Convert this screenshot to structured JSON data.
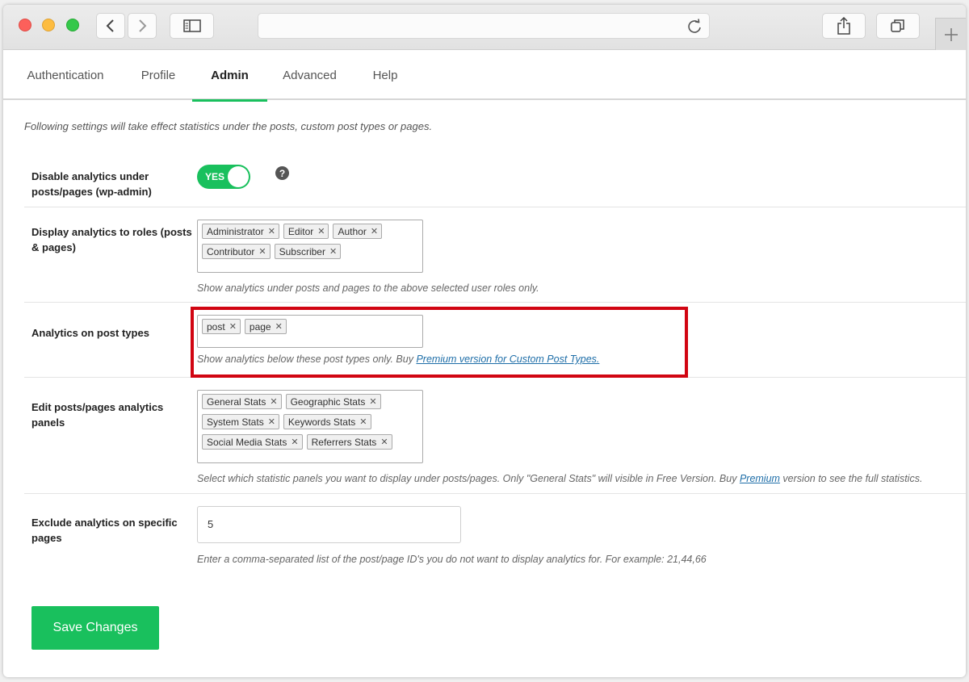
{
  "tabs": [
    {
      "label": "Authentication"
    },
    {
      "label": "Profile"
    },
    {
      "label": "Admin"
    },
    {
      "label": "Advanced"
    },
    {
      "label": "Help"
    }
  ],
  "intro": "Following settings will take effect statistics under the posts, custom post types or pages.",
  "settings": {
    "disable": {
      "label": "Disable analytics under posts/pages (wp-admin)",
      "toggle_value": "YES",
      "help_glyph": "?"
    },
    "roles": {
      "label": "Display analytics to roles (posts & pages)",
      "tags": [
        "Administrator",
        "Editor",
        "Author",
        "Contributor",
        "Subscriber"
      ],
      "description": "Show analytics under posts and pages to the above selected user roles only."
    },
    "post_types": {
      "label": "Analytics on post types",
      "tags": [
        "post",
        "page"
      ],
      "description": "Show analytics below these post types only. Buy ",
      "link_text": "Premium version for Custom Post Types."
    },
    "panels": {
      "label": "Edit posts/pages analytics panels",
      "tags": [
        "General Stats",
        "Geographic Stats",
        "System Stats",
        "Keywords Stats",
        "Social Media Stats",
        "Referrers Stats"
      ],
      "description_before": "Select which statistic panels you want to display under posts/pages. Only \"General Stats\" will visible in Free Version. Buy ",
      "link_text": "Premium",
      "description_after": " version to see the full statistics."
    },
    "exclude": {
      "label": "Exclude analytics on specific pages",
      "value": "5",
      "description": "Enter a comma-separated list of the post/page ID's you do not want to display analytics for. For example: 21,44,66"
    }
  },
  "tag_remove_glyph": "✕",
  "save_label": "Save Changes",
  "colors": {
    "accent": "#19c05d",
    "highlight": "#d10512",
    "link": "#1e6ea8"
  }
}
